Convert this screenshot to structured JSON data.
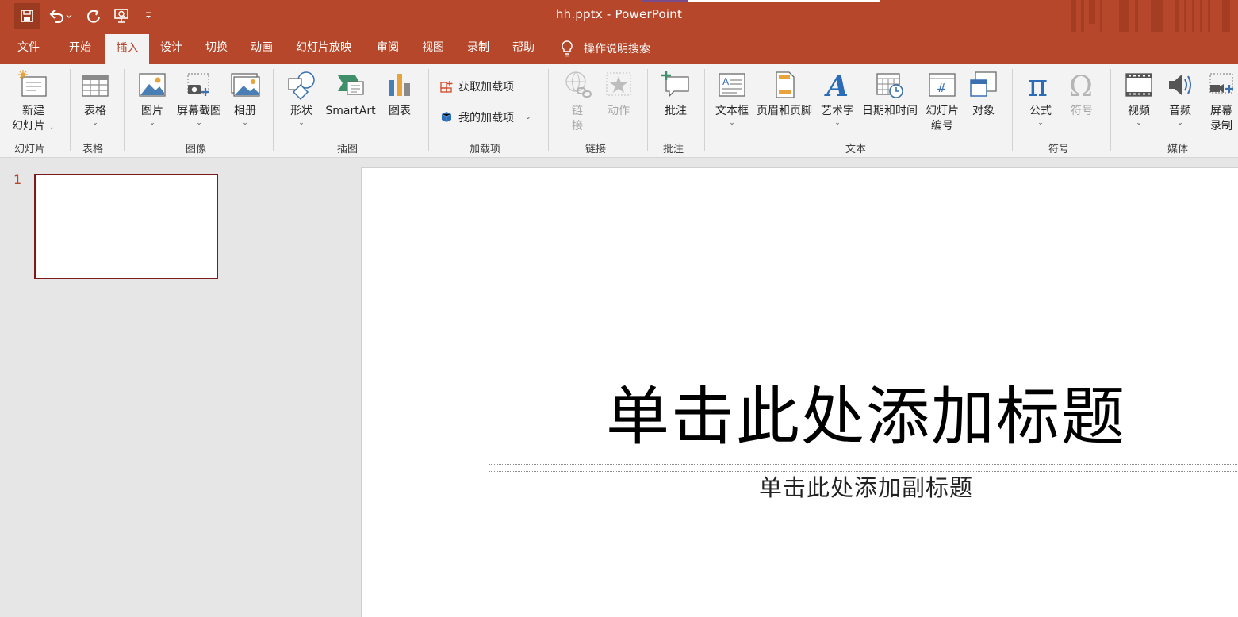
{
  "window": {
    "title": "hh.pptx  -  PowerPoint"
  },
  "quick_access": {
    "save": "save-icon",
    "undo": "undo-icon",
    "redo": "redo-icon",
    "present": "present-from-beginning-icon",
    "more": "customize-qat-icon"
  },
  "tabs": [
    {
      "label": "文件"
    },
    {
      "label": "开始"
    },
    {
      "label": "插入"
    },
    {
      "label": "设计"
    },
    {
      "label": "切换"
    },
    {
      "label": "动画"
    },
    {
      "label": "幻灯片放映"
    },
    {
      "label": "审阅"
    },
    {
      "label": "视图"
    },
    {
      "label": "录制"
    },
    {
      "label": "帮助"
    }
  ],
  "active_tab": "插入",
  "tell_me": "操作说明搜索",
  "ribbon": {
    "new_slide_line1": "新建",
    "new_slide_line2": "幻灯片",
    "table": "表格",
    "picture": "图片",
    "screenshot": "屏幕截图",
    "album": "相册",
    "shapes": "形状",
    "smartart": "SmartArt",
    "chart": "图表",
    "get_addins": "获取加载项",
    "my_addins": "我的加载项",
    "link_line1": "链",
    "link_line2": "接",
    "action": "动作",
    "comment": "批注",
    "textbox": "文本框",
    "header_footer": "页眉和页脚",
    "wordart": "艺术字",
    "datetime": "日期和时间",
    "slide_number_line1": "幻灯片",
    "slide_number_line2": "编号",
    "object": "对象",
    "equation": "公式",
    "symbol": "符号",
    "video": "视频",
    "audio": "音频",
    "screen_record_line1": "屏幕",
    "screen_record_line2": "录制",
    "groups": {
      "slides": "幻灯片",
      "tables": "表格",
      "images": "图像",
      "illustrations": "插图",
      "addins": "加载项",
      "links": "链接",
      "comments": "批注",
      "text": "文本",
      "symbols": "符号",
      "media": "媒体"
    }
  },
  "colors": {
    "accent": "#b7472a",
    "ribbon_bg": "#f3f3f3",
    "workspace_bg": "#e6e6e6"
  },
  "slides_pane": {
    "slide_number": "1"
  },
  "slide": {
    "title_placeholder": "单击此处添加标题",
    "subtitle_placeholder": "单击此处添加副标题"
  }
}
